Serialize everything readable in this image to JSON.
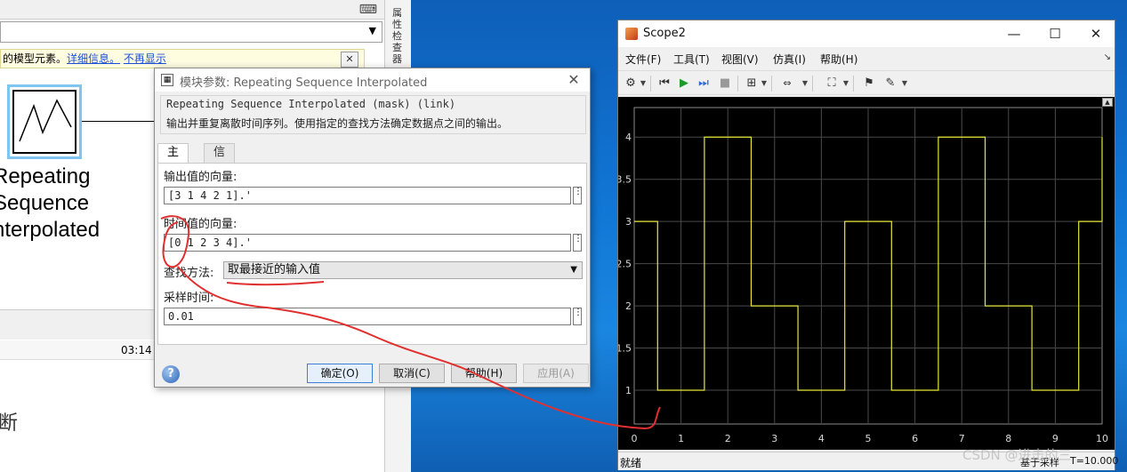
{
  "simulink": {
    "info_text": "的模型元素。",
    "info_link1": "详细信息。",
    "info_link2": "不再显示",
    "side_panel_label": "属性检查器",
    "block_label": [
      "Repeating",
      "Sequence",
      "nterpolated"
    ],
    "status_time": "03:14",
    "partial_text": "断"
  },
  "dialog": {
    "title": "模块参数: Repeating Sequence Interpolated",
    "mask_line": "Repeating Sequence Interpolated (mask) (link)",
    "description": "输出并重复离散时间序列。使用指定的查找方法确定数据点之间的输出。",
    "tabs": [
      "主要",
      "信号属性"
    ],
    "output_values_label": "输出值的向量:",
    "output_values": "[3 1 4 2 1].'",
    "time_values_label": "时间值的向量:",
    "time_values": "[0 1 2 3 4].'",
    "lookup_label": "查找方法:",
    "lookup_value": "取最接近的输入值",
    "sample_time_label": "采样时间:",
    "sample_time": "0.01",
    "buttons": {
      "ok": "确定(O)",
      "cancel": "取消(C)",
      "help": "帮助(H)",
      "apply": "应用(A)"
    }
  },
  "scope": {
    "title": "Scope2",
    "menu": [
      "文件(F)",
      "工具(T)",
      "视图(V)",
      "仿真(I)",
      "帮助(H)"
    ],
    "status_ready": "就绪",
    "status_sample": "基于采样",
    "status_time": "T=10.000"
  },
  "watermark": "CSDN @进击的三",
  "colors": {
    "signal": "#e8e83a",
    "axes_bg": "#000000",
    "grid": "#4a4a4a",
    "annotation": "#e03030"
  },
  "chart_data": {
    "type": "line",
    "title": "",
    "xlabel": "",
    "ylabel": "",
    "xlim": [
      0,
      10
    ],
    "ylim": [
      0.6,
      4.35
    ],
    "xticks": [
      0,
      1,
      2,
      3,
      4,
      5,
      6,
      7,
      8,
      9,
      10
    ],
    "yticks": [
      1,
      1.5,
      2,
      2.5,
      3,
      3.5,
      4
    ],
    "grid": true,
    "step": true,
    "series": [
      {
        "x": [
          0,
          0.5,
          1.5,
          2.5,
          3.5,
          4.5,
          5.5,
          6.5,
          7.5,
          8.5,
          9.5,
          10
        ],
        "y": [
          3,
          1,
          4,
          2,
          1,
          3,
          1,
          4,
          2,
          1,
          3,
          4
        ]
      }
    ]
  }
}
